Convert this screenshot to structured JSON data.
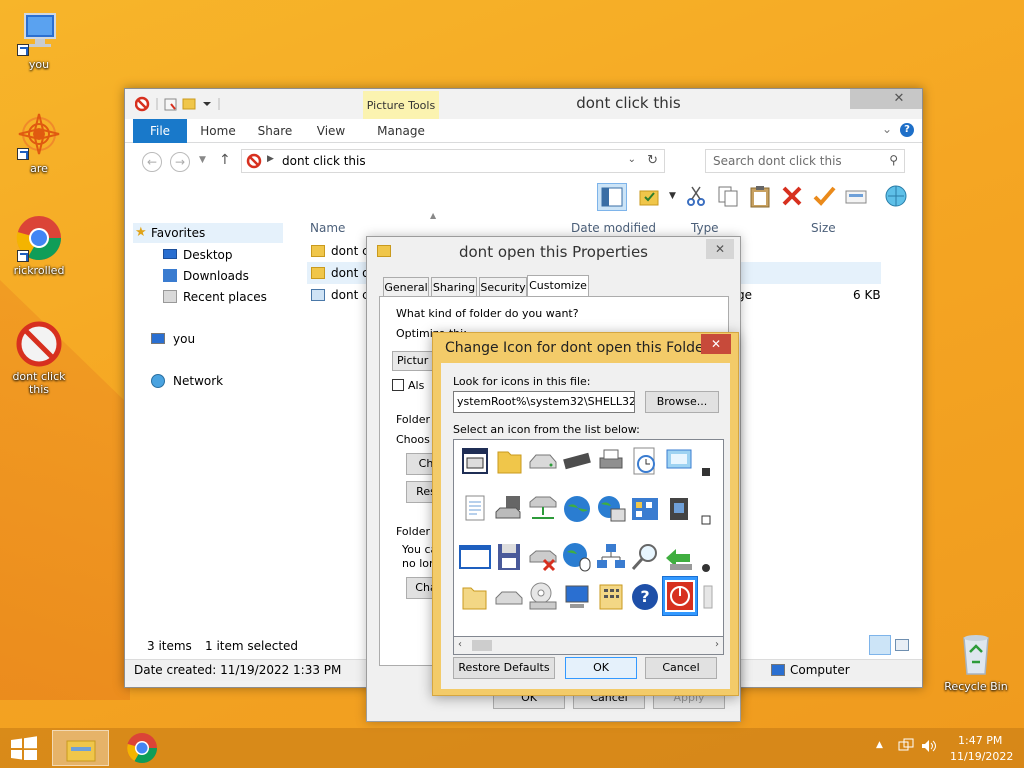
{
  "desktop": {
    "icons": [
      {
        "label": "you",
        "icon": "computer-icon"
      },
      {
        "label": "are",
        "icon": "mandala-icon"
      },
      {
        "label": "rickrolled",
        "icon": "chrome-icon"
      },
      {
        "label": "dont click this",
        "icon": "no-entry-icon"
      },
      {
        "label": "Recycle Bin",
        "icon": "recycle-bin-icon"
      }
    ]
  },
  "explorer": {
    "title": "dont click this",
    "contextual_tab_group": "Picture Tools",
    "tabs": [
      "File",
      "Home",
      "Share",
      "View",
      "Manage"
    ],
    "address": "dont click this",
    "search_placeholder": "Search dont click this",
    "nav": {
      "favorites": "Favorites",
      "desktop": "Desktop",
      "downloads": "Downloads",
      "recent": "Recent places",
      "you": "you",
      "network": "Network"
    },
    "columns": {
      "name": "Name",
      "date": "Date modified",
      "type": "Type",
      "size": "Size"
    },
    "files": [
      {
        "name": "dont c",
        "type": "",
        "size": ""
      },
      {
        "name": "dont o",
        "type": "",
        "size": ""
      },
      {
        "name": "dont c",
        "type": "ge",
        "size": "6 KB"
      }
    ],
    "status": {
      "items": "3 items",
      "selected": "1 item selected"
    },
    "details": {
      "created": "Date created: 11/19/2022 1:33 PM",
      "location": "Computer"
    }
  },
  "properties": {
    "title": "dont open this Properties",
    "tabs": [
      "General",
      "Sharing",
      "Security",
      "Customize"
    ],
    "active_tab": "Customize",
    "q_kind": "What kind of folder do you want?",
    "optimize": "Optimize this folder for:",
    "picture_frag": "Pictur",
    "also_frag": "Als",
    "folder_pictures": "Folder",
    "choose_frag": "Choos",
    "ch_frag": "Ch",
    "res_frag": "Res",
    "folder_icons": "Folder",
    "you_can": "You ca",
    "no_long": "no lon",
    "cha_frag": "Cha",
    "ok": "OK",
    "cancel": "Cancel",
    "apply": "Apply"
  },
  "change_icon": {
    "title": "Change Icon for dont open this Folder",
    "look_label": "Look for icons in this file:",
    "file_path": "ystemRoot%\\system32\\SHELL32.dll",
    "browse": "Browse...",
    "select_label": "Select an icon from the list below:",
    "restore": "Restore Defaults",
    "ok": "OK",
    "cancel": "Cancel",
    "selected_icon": "power-icon"
  },
  "taskbar": {
    "time": "1:47 PM",
    "date": "11/19/2022"
  },
  "colors": {
    "accent": "#1979ca",
    "dialog_frame": "#f3cb69",
    "close_red": "#c74a3a",
    "desktop": "#f5a623"
  }
}
